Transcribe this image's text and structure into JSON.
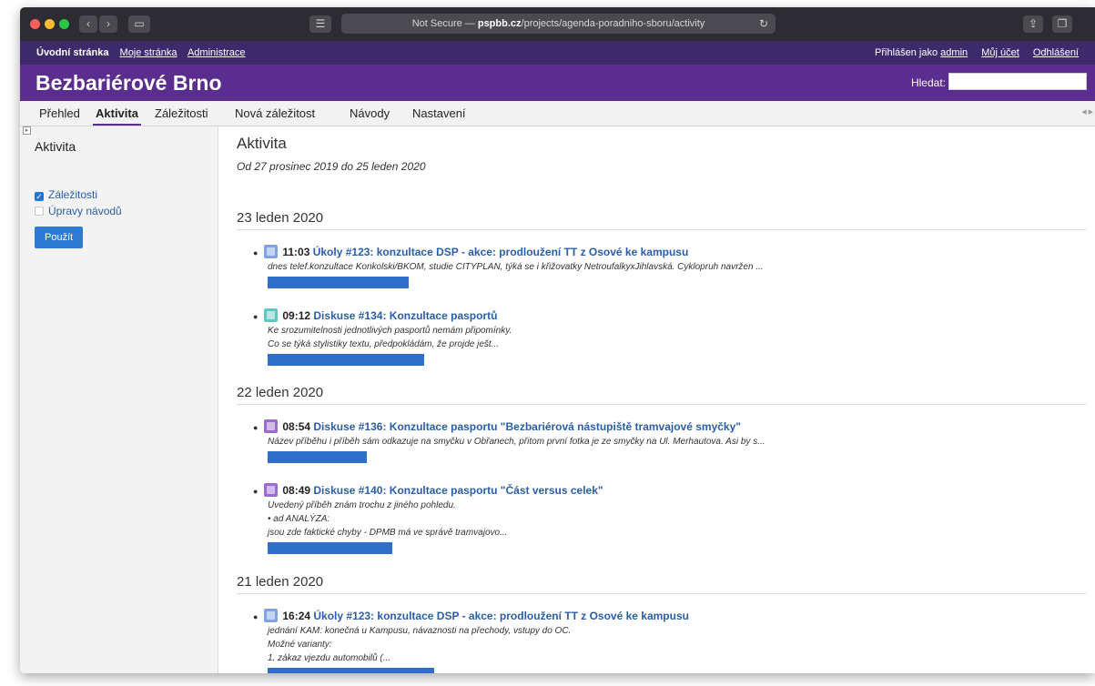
{
  "browser": {
    "address_prefix": "Not Secure — ",
    "address_host": "pspbb.cz",
    "address_path": "/projects/agenda-poradniho-sboru/activity"
  },
  "topmenu": {
    "home": "Úvodní stránka",
    "my_page": "Moje stránka",
    "admin": "Administrace",
    "logged_as": "Přihlášen jako",
    "user": "admin",
    "my_account": "Můj účet",
    "logout": "Odhlášení"
  },
  "header": {
    "title": "Bezbariérové Brno",
    "search_label": "Hledat:"
  },
  "tabs": [
    "Přehled",
    "Aktivita",
    "Záležitosti",
    "Nová záležitost",
    "Návody",
    "Nastavení"
  ],
  "sidebar": {
    "title": "Aktivita",
    "checkbox_issues": "Záležitosti",
    "checkbox_wiki": "Úpravy návodů",
    "apply": "Použít"
  },
  "main": {
    "title": "Aktivita",
    "range": "Od 27 prosinec 2019 do 25 leden 2020",
    "days": [
      {
        "date": "23 leden 2020",
        "events": [
          {
            "time": "11:03",
            "title": "Úkoly #123: konzultace DSP - akce: prodloužení TT z Osové ke kampusu",
            "lines": [
              "dnes telef.konzultace Konkolski/BKOM, studie CITYPLAN, týká se i křižovatky NetroufalkyxJihlavská. Cyklopruh navržen ..."
            ]
          },
          {
            "time": "09:12",
            "title": "Diskuse #134: Konzultace pasportů",
            "lines": [
              "Ke srozumitelnosti jednotlivých pasportů nemám připomínky.",
              "Co se týká stylistiky textu, předpokládám, že projde ješt..."
            ]
          }
        ]
      },
      {
        "date": "22 leden 2020",
        "events": [
          {
            "time": "08:54",
            "title": "Diskuse #136: Konzultace pasportu \"Bezbariérová nástupiště tramvajové smyčky\"",
            "lines": [
              "Název příběhu i příběh sám odkazuje na smyčku v Obřanech, přitom první fotka je ze smyčky na Ul. Merhautova. Asi by s..."
            ]
          },
          {
            "time": "08:49",
            "title": "Diskuse #140: Konzultace pasportu \"Část versus celek\"",
            "lines": [
              "Uvedený příběh znám trochu z jiného pohledu.",
              "• ad ANALÝZA:",
              "jsou zde faktické chyby - DPMB má ve správě tramvajovo..."
            ]
          }
        ]
      },
      {
        "date": "21 leden 2020",
        "events": [
          {
            "time": "16:24",
            "title": "Úkoly #123: konzultace DSP - akce: prodloužení TT z Osové ke kampusu",
            "lines": [
              "jednání KAM: konečná u Kampusu, návaznosti na přechody, vstupy do OC.",
              "Možné varianty:",
              "1. zákaz vjezdu automobilů (..."
            ]
          }
        ]
      }
    ]
  }
}
